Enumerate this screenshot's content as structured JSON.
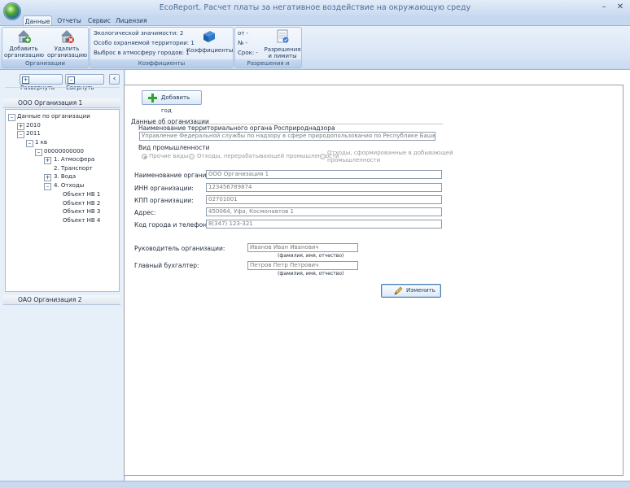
{
  "window": {
    "title": "EcoReport. Расчет платы за негативное воздействие на окружающую среду",
    "minimize_glyph": "–",
    "close_glyph": "✕"
  },
  "ribbon": {
    "tabs": [
      "Данные",
      "Отчеты",
      "Сервис",
      "Лицензия"
    ],
    "active_tab": "Данные",
    "groups": {
      "organizations": {
        "label": "Организации",
        "add_label_1": "Добавить",
        "add_label_2": "организацию",
        "delete_label_1": "Удалить",
        "delete_label_2": "организацию"
      },
      "coefficients": {
        "label": "Коэффициенты",
        "lines": [
          "Экологической значимости: 2",
          "Особо охраняемой территории: 1",
          "Выброс в атмосферу городов: 1"
        ],
        "button_label": "Коэффициенты"
      },
      "permits": {
        "label": "Разрешения и лимиты",
        "lines": [
          "от -",
          "№ -",
          "Срок: -"
        ],
        "button_label_1": "Разрешения",
        "button_label_2": "и лимиты"
      }
    }
  },
  "sidebar": {
    "expand_label": "Развернуть",
    "collapse_label": "Свернуть",
    "org1": "ООО Организация 1",
    "org2": "ОАО Организация 2",
    "tree": {
      "root": "Данные по организации",
      "y2010": "2010",
      "y2011": "2011",
      "quarter": "1 кв",
      "code": "00000000000",
      "items": [
        "1. Атмосфера",
        "2. Транспорт",
        "3. Вода",
        "4. Отходы"
      ],
      "objects": [
        "Объект НВ 1",
        "Объект НВ 2",
        "Объект НВ 3",
        "Объект НВ 4"
      ]
    }
  },
  "form": {
    "add_year_label": "Добавить год",
    "section_title": "Данные об организации",
    "rpn_label": "Наименование территориального органа Росприроднадзора",
    "rpn_value": "Управление Федеральной службы по надзору в сфере природопользования по Республике Башкортостан",
    "industry_label": "Вид промышленности",
    "industry_options": [
      "Прочие виды",
      "Отходы, перерабатывающей промышленности",
      "Отходы, сформированные в добывающей",
      "промышленности"
    ],
    "fields": [
      {
        "label": "Наименование организации:",
        "value": "ООО Организация 1"
      },
      {
        "label": "ИНН организации:",
        "value": "123456789874"
      },
      {
        "label": "КПП организации:",
        "value": "02701001"
      },
      {
        "label": "Адрес:",
        "value": "450064, Уфа, Космонавтов 1"
      },
      {
        "label": "Код города и телефон:",
        "value": "8(347) 123-321"
      }
    ],
    "head_label": "Руководитель организации:",
    "head_value": "Иванов Иван Иванович",
    "accountant_label": "Главный бухгалтер:",
    "accountant_value": "Петров Петр Петрович",
    "fio_hint": "(фамилия, имя, отчество)",
    "edit_label": "Изменить"
  }
}
